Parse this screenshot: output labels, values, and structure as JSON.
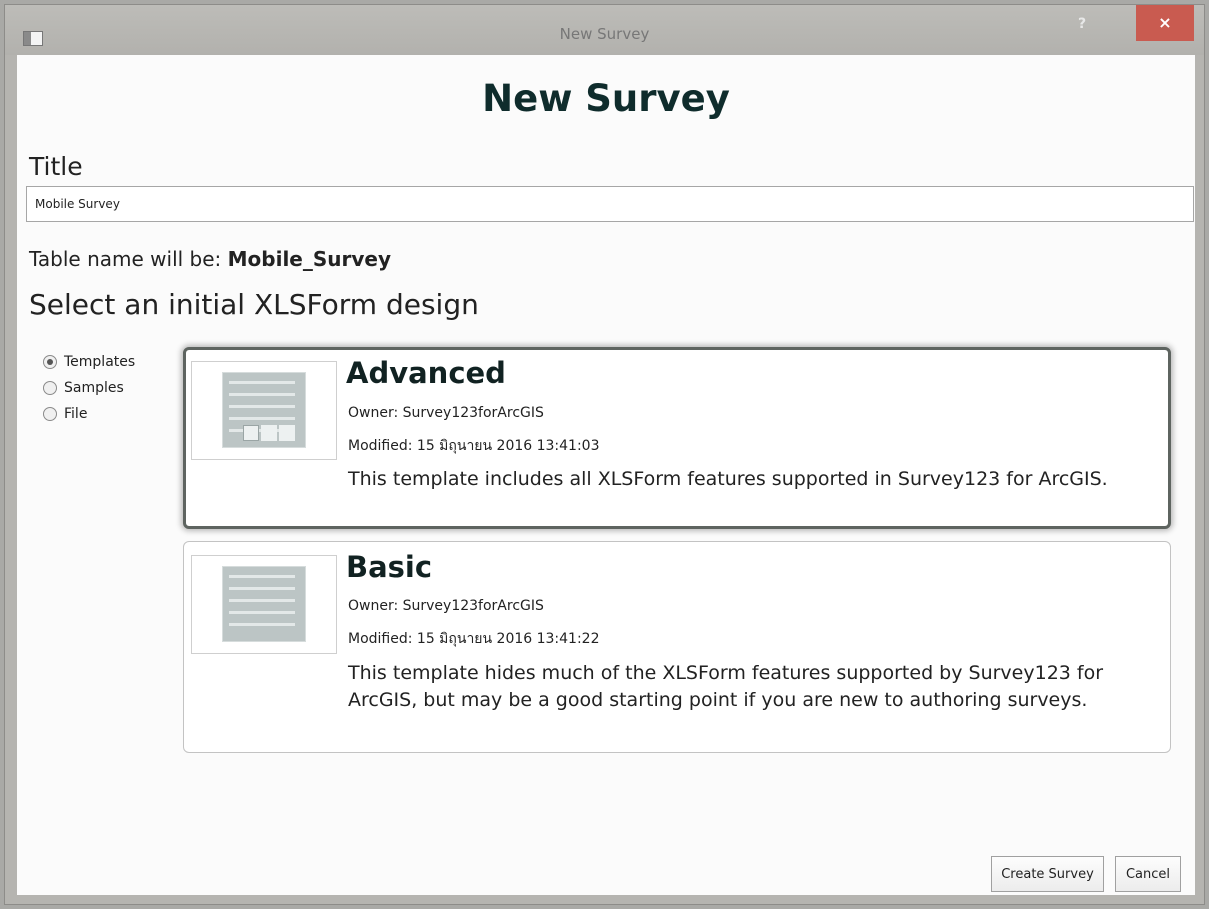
{
  "window": {
    "title": "New Survey",
    "help_label": "?",
    "close_label": "×"
  },
  "heading": "New Survey",
  "title_label": "Title",
  "title_input": {
    "value": "Mobile Survey"
  },
  "table_name": {
    "prefix": "Table name will be:",
    "value": "Mobile_Survey"
  },
  "select_label": "Select an initial XLSForm design",
  "sources": [
    {
      "label": "Templates",
      "selected": true
    },
    {
      "label": "Samples",
      "selected": false
    },
    {
      "label": "File",
      "selected": false
    }
  ],
  "templates": [
    {
      "title": "Advanced",
      "owner": "Owner: Survey123forArcGIS",
      "modified": "Modified: 15 มิถุนายน 2016 13:41:03",
      "description": "This template includes all XLSForm features supported in Survey123 for ArcGIS.",
      "selected": true
    },
    {
      "title": "Basic",
      "owner": "Owner: Survey123forArcGIS",
      "modified": "Modified: 15 มิถุนายน 2016 13:41:22",
      "description": "This template hides much of the XLSForm features supported by Survey123 for ArcGIS, but may be a good starting point if you are new to authoring surveys.",
      "selected": false
    }
  ],
  "buttons": {
    "create": "Create Survey",
    "cancel": "Cancel"
  }
}
